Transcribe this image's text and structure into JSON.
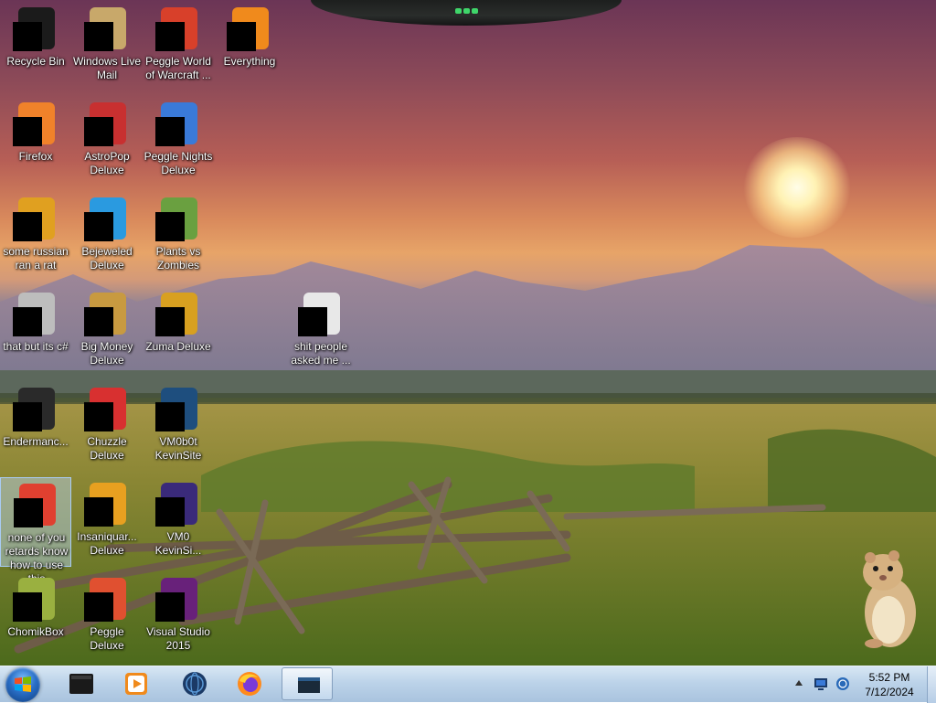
{
  "desktop": {
    "icons": [
      {
        "label": "Recycle Bin",
        "icon": "recycle-bin-icon",
        "color": "#1b1b1b"
      },
      {
        "label": "Windows Live Mail",
        "icon": "windows-live-mail-icon",
        "color": "#c8a86a"
      },
      {
        "label": "Peggle World of Warcraft ...",
        "icon": "peggle-wow-icon",
        "color": "#d8402a"
      },
      {
        "label": "Everything",
        "icon": "everything-icon",
        "color": "#f08a1c"
      },
      {
        "label": "Firefox",
        "icon": "firefox-icon",
        "color": "#f0822a"
      },
      {
        "label": "AstroPop Deluxe",
        "icon": "astropop-icon",
        "color": "#c83030"
      },
      {
        "label": "Peggle Nights Deluxe",
        "icon": "peggle-nights-icon",
        "color": "#3a7ad8"
      },
      {
        "label": "some russian ran a rat",
        "icon": "rat-program-icon",
        "color": "#e0a020"
      },
      {
        "label": "Bejeweled Deluxe",
        "icon": "bejeweled-icon",
        "color": "#2a9ae0"
      },
      {
        "label": "Plants vs Zombies",
        "icon": "plants-vs-zombies-icon",
        "color": "#6aa040"
      },
      {
        "label": "that but its c#",
        "icon": "stacked-windows-icon",
        "color": "#bdbdbd"
      },
      {
        "label": "Big Money Deluxe",
        "icon": "big-money-icon",
        "color": "#c89a40"
      },
      {
        "label": "Zuma Deluxe",
        "icon": "zuma-icon",
        "color": "#d8a020"
      },
      {
        "label": "shit people asked me ...",
        "icon": "folder-icon",
        "color": "#e8e8e8"
      },
      {
        "label": "Endermanc...",
        "icon": "endermanch-icon",
        "color": "#2a2a2a"
      },
      {
        "label": "Chuzzle Deluxe",
        "icon": "chuzzle-icon",
        "color": "#d83030"
      },
      {
        "label": "VM0b0t KevinSite",
        "icon": "vm-window-icon",
        "color": "#1e4e7e"
      },
      {
        "label": "none of you retards know how to use this",
        "icon": "peggle-icon",
        "color": "#e04030"
      },
      {
        "label": "Insaniquar... Deluxe",
        "icon": "insaniquarium-icon",
        "color": "#e8a020"
      },
      {
        "label": "VM0 KevinSi...",
        "icon": "vm-purple-icon",
        "color": "#3a2a7a"
      },
      {
        "label": "ChomikBox",
        "icon": "chomikbox-icon",
        "color": "#9ab040"
      },
      {
        "label": "Peggle Deluxe",
        "icon": "peggle-deluxe-icon",
        "color": "#e05030"
      },
      {
        "label": "Visual Studio 2015",
        "icon": "visual-studio-icon",
        "color": "#68217a"
      }
    ]
  },
  "taskbar": {
    "start": {
      "icon": "windows-start-icon"
    },
    "pinned": [
      {
        "name": "Command Prompt",
        "icon": "terminal-icon",
        "active": false
      },
      {
        "name": "Windows Media Player",
        "icon": "media-player-icon",
        "active": false
      },
      {
        "name": "Globe",
        "icon": "globe-icon",
        "active": false
      },
      {
        "name": "Firefox",
        "icon": "firefox-icon",
        "active": false
      },
      {
        "name": "Open Window",
        "icon": "window-icon",
        "active": true
      }
    ],
    "tray": {
      "icons": [
        "show-hidden-icons-arrow",
        "monitor-icon",
        "network-icon"
      ],
      "time": "5:52 PM",
      "date": "7/12/2024"
    }
  }
}
